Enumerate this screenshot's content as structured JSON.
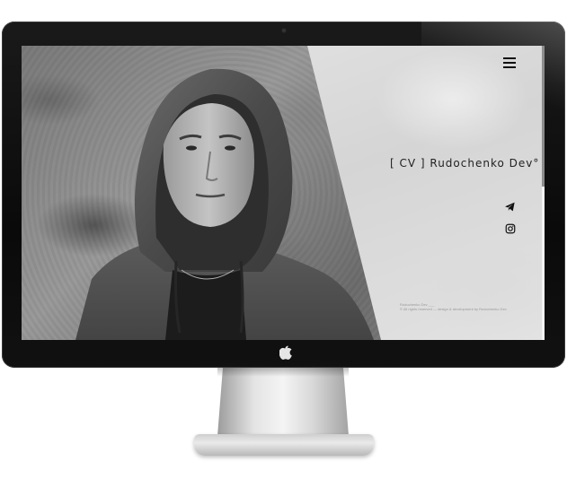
{
  "site": {
    "title": "[ CV ] Rudochenko Dev°",
    "footer_line_1": "Rudochenko Dev ___",
    "footer_line_2": "© All rights reserved — design & development by Rudochenko Dev"
  },
  "icons": {
    "menu": "hamburger-menu-icon",
    "telegram": "telegram-icon",
    "instagram": "instagram-icon",
    "apple": "apple-logo-icon"
  },
  "colors": {
    "bezel": "#0d0d0d",
    "screen_light": "#e2e2e2",
    "text": "#222222",
    "stand": "#d8d8d8"
  },
  "scroll": {
    "position_fraction": 0.0,
    "thumb_fraction": 0.48
  }
}
